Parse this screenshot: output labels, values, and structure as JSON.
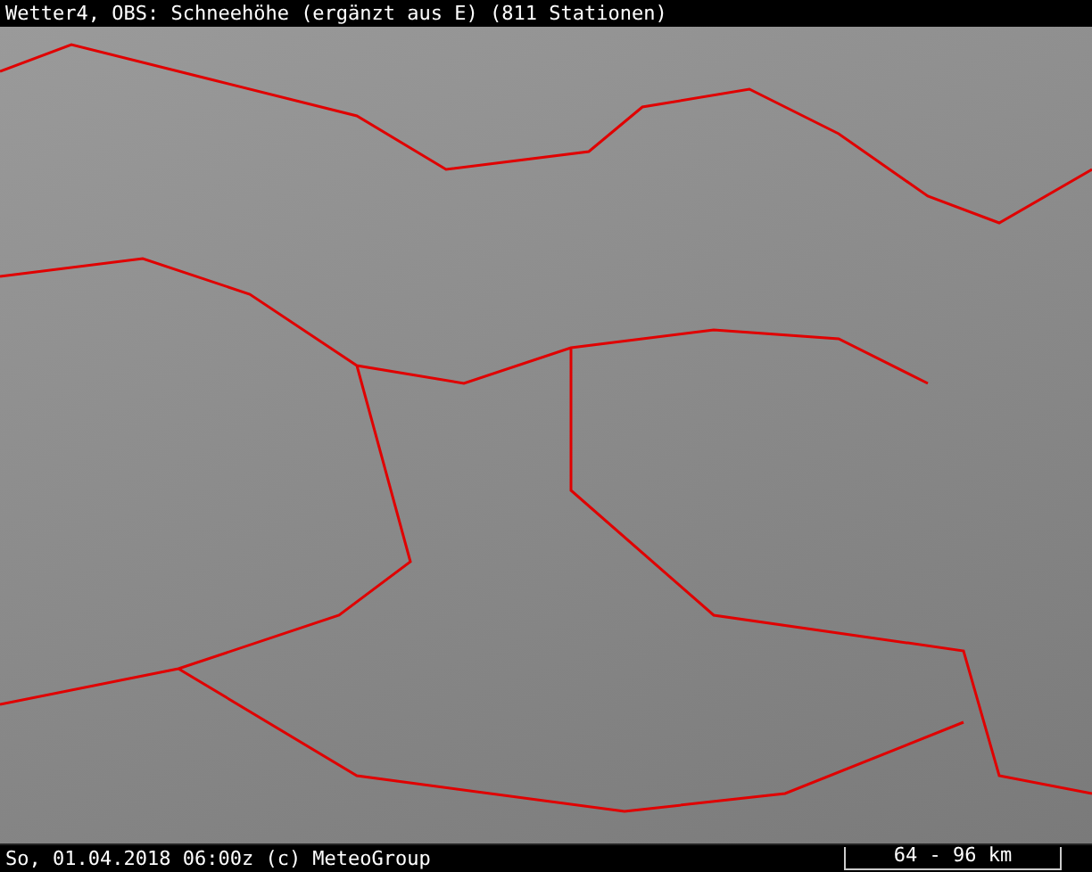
{
  "header": {
    "title": "Wetter4, OBS: Schneehöhe (ergänzt aus E) (811 Stationen)"
  },
  "footer": {
    "caption": "So, 01.04.2018 06:00z (c) MeteoGroup",
    "scale": "64 - 96 km"
  }
}
